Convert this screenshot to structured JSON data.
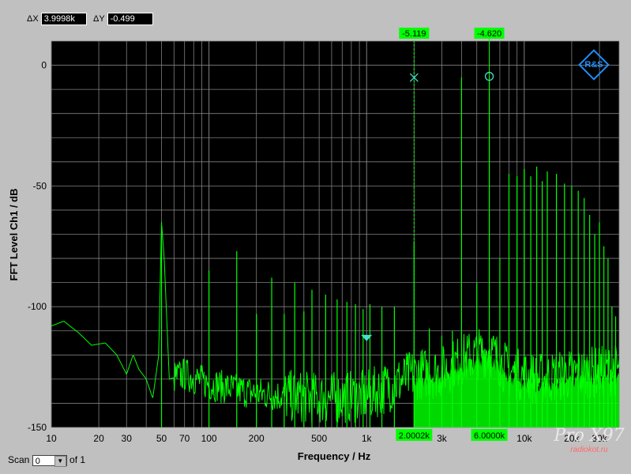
{
  "delta": {
    "x_label": "ΔX",
    "x_value": "3.9998k",
    "y_label": "ΔY",
    "y_value": "-0.499"
  },
  "scan": {
    "label": "Scan",
    "value": "0",
    "of_label": "of 1"
  },
  "watermark": {
    "text": "Pro X97",
    "site": "radiokot.ru"
  },
  "colors": {
    "trace": "#00ff00",
    "plot_bg": "#000000",
    "grid": "#808080",
    "frame_bg": "#c0c0c0",
    "marker": "#40e0d0"
  },
  "icons": {
    "logo": "rs-logo-icon",
    "markers": [
      "x-marker-icon",
      "o-marker-icon",
      "triangle-marker-icon"
    ]
  },
  "chart_data": {
    "type": "line",
    "xlabel": "Frequency / Hz",
    "ylabel": "FFT Level Ch1 / dB",
    "xscale": "log",
    "xlim": [
      10,
      40000
    ],
    "ylim": [
      -150,
      10
    ],
    "x_ticks": [
      {
        "v": 10,
        "label": "10"
      },
      {
        "v": 20,
        "label": "20"
      },
      {
        "v": 30,
        "label": "30"
      },
      {
        "v": 50,
        "label": "50"
      },
      {
        "v": 70,
        "label": "70"
      },
      {
        "v": 100,
        "label": "100"
      },
      {
        "v": 200,
        "label": "200"
      },
      {
        "v": 500,
        "label": "500"
      },
      {
        "v": 1000,
        "label": "1k"
      },
      {
        "v": 3000,
        "label": "3k"
      },
      {
        "v": 10000,
        "label": "10k"
      },
      {
        "v": 20000,
        "label": "20k"
      },
      {
        "v": 30000,
        "label": "30k"
      }
    ],
    "y_ticks": [
      {
        "v": 0,
        "label": "0"
      },
      {
        "v": -50,
        "label": "-50"
      },
      {
        "v": -100,
        "label": "-100"
      },
      {
        "v": -150,
        "label": "-150"
      }
    ],
    "grid": true,
    "noise_floor": [
      [
        10,
        -108
      ],
      [
        12,
        -106
      ],
      [
        15,
        -111
      ],
      [
        18,
        -116
      ],
      [
        22,
        -115
      ],
      [
        26,
        -120
      ],
      [
        30,
        -128
      ],
      [
        33,
        -120
      ],
      [
        36,
        -126
      ],
      [
        40,
        -130
      ],
      [
        44,
        -138
      ],
      [
        48,
        -120
      ],
      [
        50,
        -65
      ],
      [
        52,
        -80
      ],
      [
        56,
        -130
      ],
      [
        70,
        -128
      ],
      [
        100,
        -132
      ],
      [
        200,
        -136
      ],
      [
        500,
        -138
      ],
      [
        1000,
        -137
      ],
      [
        1500,
        -132
      ],
      [
        2000,
        -128
      ],
      [
        3000,
        -127
      ],
      [
        4000,
        -122
      ],
      [
        6000,
        -118
      ],
      [
        8000,
        -127
      ],
      [
        12000,
        -130
      ],
      [
        20000,
        -128
      ],
      [
        30000,
        -127
      ],
      [
        40000,
        -126
      ]
    ],
    "spurs": [
      {
        "x": 50,
        "y": -65
      },
      {
        "x": 100,
        "y": -85
      },
      {
        "x": 150,
        "y": -77
      },
      {
        "x": 200,
        "y": -103
      },
      {
        "x": 250,
        "y": -88
      },
      {
        "x": 300,
        "y": -103
      },
      {
        "x": 350,
        "y": -90
      },
      {
        "x": 400,
        "y": -102
      },
      {
        "x": 450,
        "y": -93
      },
      {
        "x": 550,
        "y": -95
      },
      {
        "x": 650,
        "y": -97
      },
      {
        "x": 750,
        "y": -98
      },
      {
        "x": 850,
        "y": -99
      },
      {
        "x": 950,
        "y": -101
      },
      {
        "x": 1050,
        "y": -99
      },
      {
        "x": 1250,
        "y": -100
      },
      {
        "x": 1500,
        "y": -100
      },
      {
        "x": 2000,
        "y": -73
      },
      {
        "x": 2500,
        "y": -109
      },
      {
        "x": 3000,
        "y": -112
      },
      {
        "x": 3500,
        "y": -110
      },
      {
        "x": 4000,
        "y": -5
      },
      {
        "x": 5000,
        "y": -90
      },
      {
        "x": 6000,
        "y": -4.6
      },
      {
        "x": 7000,
        "y": -80
      },
      {
        "x": 8000,
        "y": -45
      },
      {
        "x": 9000,
        "y": -46
      },
      {
        "x": 10000,
        "y": -43
      },
      {
        "x": 11000,
        "y": -46
      },
      {
        "x": 12000,
        "y": -42
      },
      {
        "x": 13000,
        "y": -48
      },
      {
        "x": 14000,
        "y": -44
      },
      {
        "x": 16000,
        "y": -45
      },
      {
        "x": 18000,
        "y": -49
      },
      {
        "x": 20000,
        "y": -50
      },
      {
        "x": 22000,
        "y": -52
      },
      {
        "x": 24000,
        "y": -55
      },
      {
        "x": 26000,
        "y": -62
      },
      {
        "x": 28000,
        "y": -70
      },
      {
        "x": 30000,
        "y": -65
      },
      {
        "x": 32000,
        "y": -75
      },
      {
        "x": 34000,
        "y": -80
      },
      {
        "x": 36000,
        "y": -100
      },
      {
        "x": 38000,
        "y": -104
      }
    ],
    "cursors": [
      {
        "name": "cursor-1",
        "x": 2000.2,
        "y": -5.119,
        "x_label": "2.0002k",
        "y_label": "-5.119",
        "symbol": "x"
      },
      {
        "name": "cursor-2",
        "x": 6000.0,
        "y": -4.62,
        "x_label": "6.0000k",
        "y_label": "-4.620",
        "symbol": "o"
      }
    ],
    "marker_point": {
      "x": 1000,
      "y": -113,
      "symbol": "triangle"
    }
  }
}
